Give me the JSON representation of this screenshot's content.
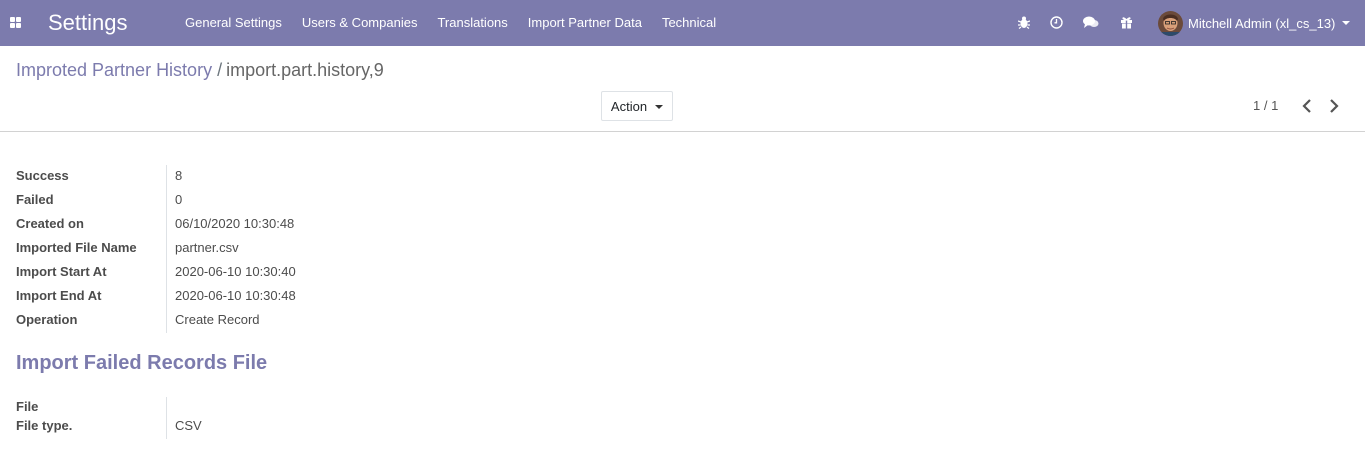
{
  "navbar": {
    "app_title": "Settings",
    "menu": [
      "General Settings",
      "Users & Companies",
      "Translations",
      "Import Partner Data",
      "Technical"
    ],
    "icons": [
      "bug-icon",
      "clock-icon",
      "chat-icon",
      "gift-icon"
    ],
    "user_name": "Mitchell Admin (xl_cs_13)",
    "bg_color": "#7c7bad"
  },
  "breadcrumb": {
    "parent": "Improted Partner History",
    "separator": "/",
    "current": "import.part.history,9"
  },
  "control_panel": {
    "action_label": "Action",
    "pager": "1 / 1"
  },
  "record": {
    "fields": [
      {
        "label": "Success",
        "value": "8"
      },
      {
        "label": "Failed",
        "value": "0"
      },
      {
        "label": "Created on",
        "value": "06/10/2020 10:30:48"
      },
      {
        "label": "Imported File Name",
        "value": "partner.csv"
      },
      {
        "label": "Import Start At",
        "value": "2020-06-10 10:30:40"
      },
      {
        "label": "Import End At",
        "value": "2020-06-10 10:30:48"
      },
      {
        "label": "Operation",
        "value": "Create Record"
      }
    ],
    "section_title": "Import Failed Records File",
    "file_fields": [
      {
        "label": "File",
        "value": ""
      },
      {
        "label": "File type.",
        "value": "CSV"
      }
    ]
  }
}
